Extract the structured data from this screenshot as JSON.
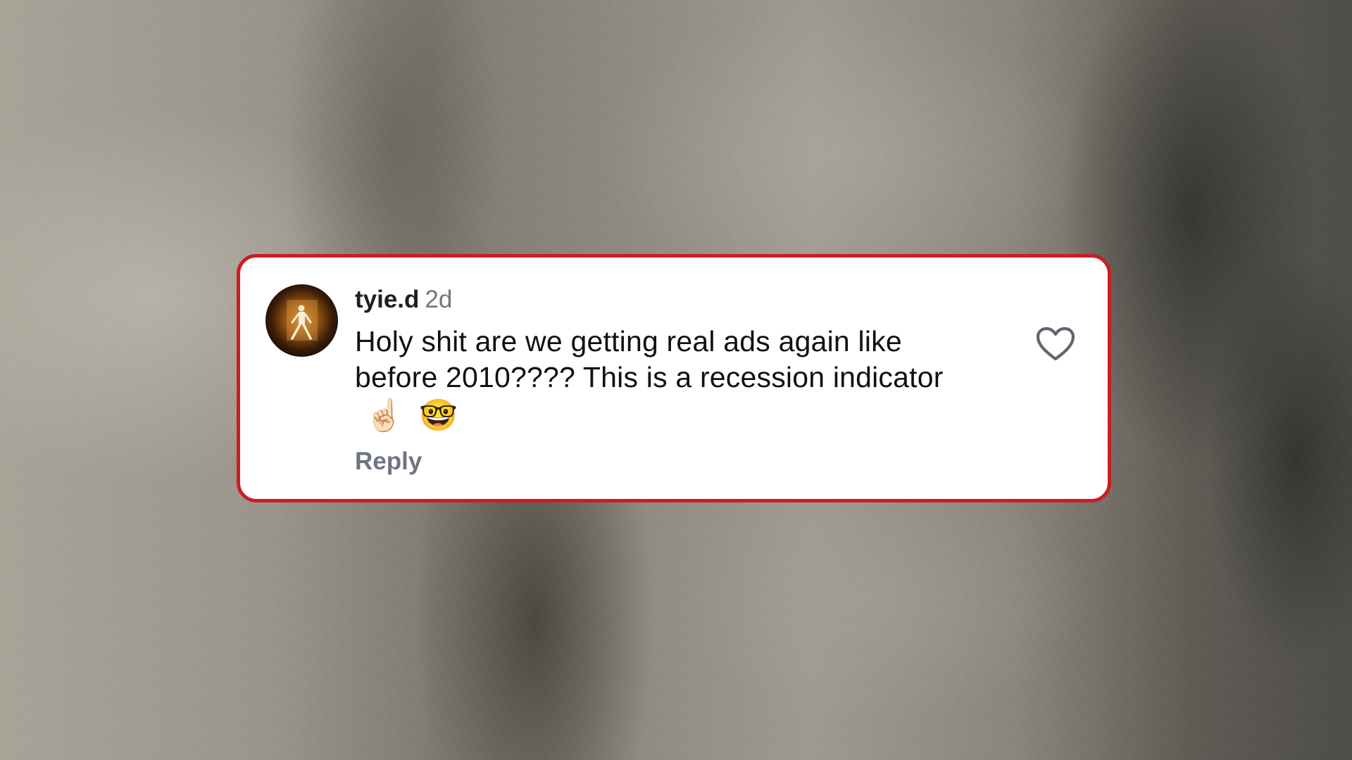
{
  "comment": {
    "username": "tyie.d",
    "timestamp": "2d",
    "text": "Holy shit are we getting real ads again like before 2010???? This is a recession indicator",
    "emojis": [
      "☝🏻",
      "🤓"
    ],
    "reply_label": "Reply",
    "like_icon": "heart-outline-icon",
    "avatar_icon": "figure-in-light-avatar"
  },
  "colors": {
    "card_border": "#c81e24",
    "username": "#1f1f1f",
    "muted": "#707780"
  }
}
